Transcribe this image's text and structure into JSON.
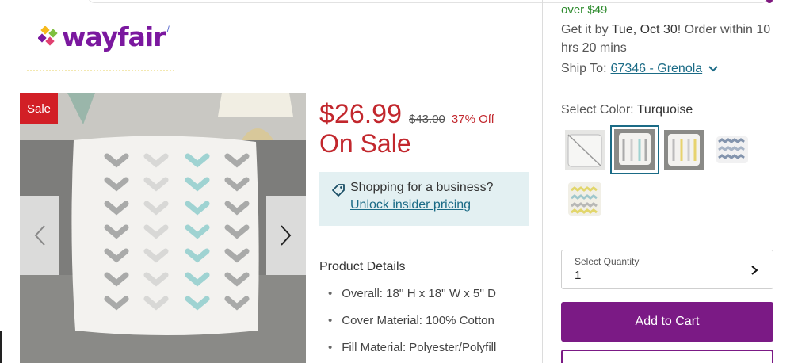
{
  "brand": {
    "name": "wayfair",
    "mark": "/"
  },
  "gallery": {
    "sale_badge": "Sale",
    "prev_icon": "chevron-left-icon",
    "next_icon": "chevron-right-icon"
  },
  "pricing": {
    "current": "$26.99",
    "original": "$43.00",
    "discount": "37% Off",
    "sale_heading": "On Sale"
  },
  "business": {
    "icon": "tag-icon",
    "title": "Shopping for a business?",
    "link": "Unlock insider pricing"
  },
  "details": {
    "title": "Product Details",
    "items": [
      "Overall: 18'' H x 18'' W x 5'' D",
      "Cover Material: 100% Cotton",
      "Fill Material: Polyester/Polyfill"
    ]
  },
  "shipping": {
    "free_over": "over $49",
    "delivery_prefix": "Get it by ",
    "delivery_date": "Tue, Oct 30",
    "delivery_suffix": "! Order within 10 hrs 20 mins",
    "ship_to_label": "Ship To:",
    "zip_location": "67346 - Grenola"
  },
  "color": {
    "label": "Select Color:",
    "selected": "Turquoise",
    "swatches": [
      "swatch-1",
      "swatch-2",
      "swatch-3",
      "swatch-4",
      "swatch-5"
    ]
  },
  "quantity": {
    "label": "Select Quantity",
    "value": "1"
  },
  "actions": {
    "add_to_cart": "Add to Cart"
  },
  "colors": {
    "sale_red": "#c2272d",
    "brand_purple": "#7b1a85",
    "link_teal": "#1b6b86",
    "ship_green": "#2e8b2e",
    "biz_bg": "#e3f0f2"
  }
}
